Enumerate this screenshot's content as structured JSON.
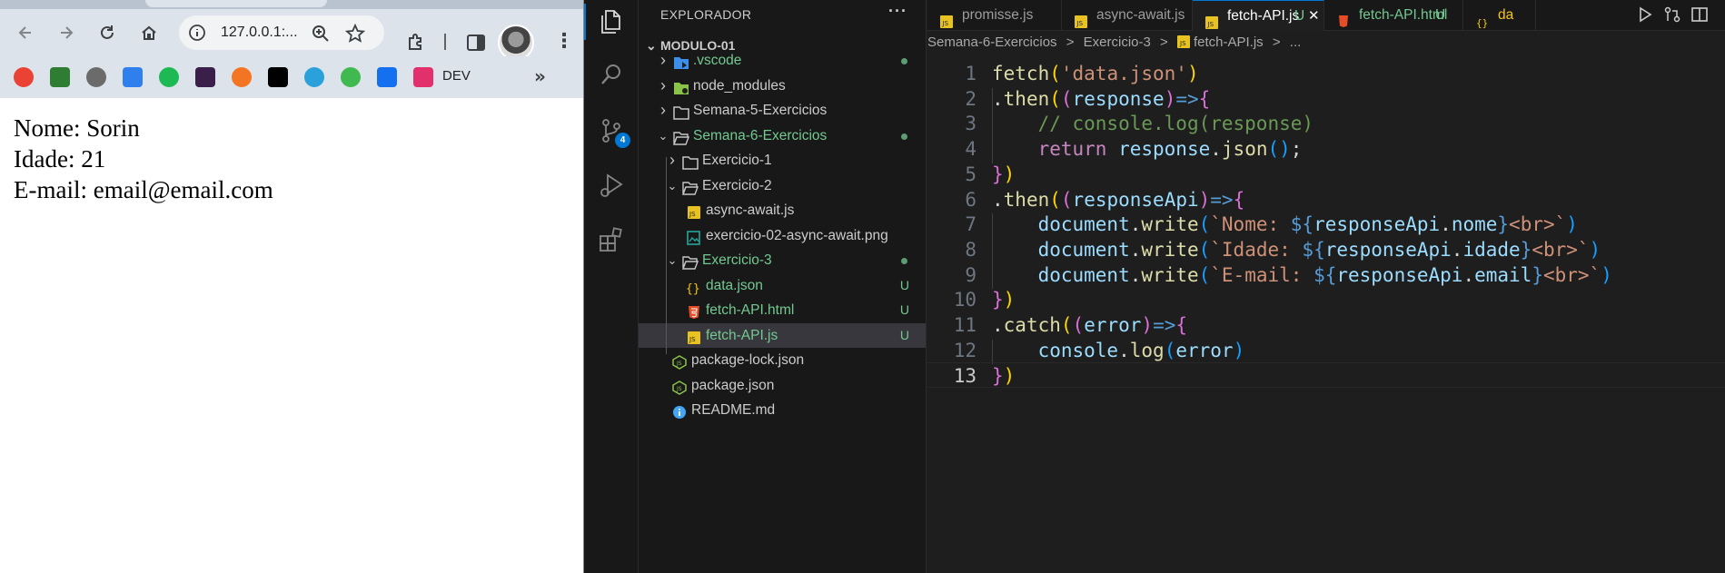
{
  "browser": {
    "url": "127.0.0.1:...",
    "bookmarks": [
      {
        "icon": "chrome-colorful-icon",
        "color": "#ea4335"
      },
      {
        "icon": "sheets-icon",
        "color": "#2f7d32"
      },
      {
        "icon": "globe-icon",
        "color": "#6b6b6b"
      },
      {
        "icon": "cloud-icon",
        "color": "#2f80ed"
      },
      {
        "icon": "spotify-icon",
        "color": "#1db954"
      },
      {
        "icon": "m-icon",
        "color": "#3a1f4b"
      },
      {
        "icon": "crunchyroll-icon",
        "color": "#f47521"
      },
      {
        "icon": "x-icon",
        "color": "#000000"
      },
      {
        "icon": "telegram-icon",
        "color": "#2aa1da"
      },
      {
        "icon": "one-icon",
        "color": "#3fb950"
      },
      {
        "icon": "s-icon",
        "color": "#1570ef"
      },
      {
        "icon": "dev-icon",
        "color": "#e1306c"
      }
    ],
    "bookmark_label": "DEV",
    "page_lines": [
      "Nome: Sorin",
      "Idade: 21",
      "E-mail: email@email.com"
    ]
  },
  "vscode": {
    "explorer_title": "EXPLORADOR",
    "root_folder": "MODULO-01",
    "scm_badge": "4",
    "tree": [
      {
        "label": ".vscode",
        "depth": 1,
        "kind": "folder-vscode",
        "expanded": false,
        "status": "dot",
        "added": true
      },
      {
        "label": "node_modules",
        "depth": 1,
        "kind": "folder-node",
        "expanded": false,
        "status": "",
        "added": false
      },
      {
        "label": "Semana-5-Exercicios",
        "depth": 1,
        "kind": "folder",
        "expanded": false,
        "status": "",
        "added": false
      },
      {
        "label": "Semana-6-Exercicios",
        "depth": 1,
        "kind": "folder-open",
        "expanded": true,
        "status": "dot",
        "added": true
      },
      {
        "label": "Exercicio-1",
        "depth": 2,
        "kind": "folder",
        "expanded": false,
        "status": "",
        "added": false
      },
      {
        "label": "Exercicio-2",
        "depth": 2,
        "kind": "folder-open",
        "expanded": true,
        "status": "",
        "added": false
      },
      {
        "label": "async-await.js",
        "depth": 3,
        "kind": "js",
        "status": "",
        "added": false
      },
      {
        "label": "exercicio-02-async-await.png",
        "depth": 3,
        "kind": "png",
        "status": "",
        "added": false
      },
      {
        "label": "Exercicio-3",
        "depth": 2,
        "kind": "folder-open",
        "expanded": true,
        "status": "dot",
        "added": true
      },
      {
        "label": "data.json",
        "depth": 3,
        "kind": "json",
        "status": "U",
        "added": true
      },
      {
        "label": "fetch-API.html",
        "depth": 3,
        "kind": "html",
        "status": "U",
        "added": true
      },
      {
        "label": "fetch-API.js",
        "depth": 3,
        "kind": "js",
        "status": "U",
        "added": true,
        "selected": true
      },
      {
        "label": "package-lock.json",
        "depth": 1,
        "kind": "npm",
        "status": "",
        "added": false
      },
      {
        "label": "package.json",
        "depth": 1,
        "kind": "npm",
        "status": "",
        "added": false
      },
      {
        "label": "README.md",
        "depth": 1,
        "kind": "info",
        "status": "",
        "added": false
      }
    ],
    "tabs": [
      {
        "label": "promisse.js",
        "kind": "js",
        "status": "",
        "active": false
      },
      {
        "label": "async-await.js",
        "kind": "js",
        "status": "",
        "active": false
      },
      {
        "label": "fetch-API.js",
        "kind": "js",
        "status": "U",
        "active": true
      },
      {
        "label": "fetch-API.html",
        "kind": "html",
        "status": "U",
        "active": false
      },
      {
        "label": "da",
        "kind": "json",
        "status": "",
        "active": false
      }
    ],
    "breadcrumb": [
      "Semana-6-Exercicios",
      ">",
      "Exercicio-3",
      ">",
      "fetch-API.js",
      ">",
      "..."
    ],
    "line_numbers": [
      "1",
      "2",
      "3",
      "4",
      "5",
      "6",
      "7",
      "8",
      "9",
      "10",
      "11",
      "12",
      "13"
    ],
    "current_line": 13,
    "code": [
      [
        [
          "fn",
          "fetch"
        ],
        [
          "b1",
          "("
        ],
        [
          "str",
          "'data.json'"
        ],
        [
          "b1",
          ")"
        ]
      ],
      [
        [
          "p",
          "."
        ],
        [
          "fn",
          "then"
        ],
        [
          "b1",
          "("
        ],
        [
          "b2",
          "("
        ],
        [
          "var",
          "response"
        ],
        [
          "b2",
          ")"
        ],
        [
          "op",
          "=>"
        ],
        [
          "b2",
          "{"
        ]
      ],
      [
        [
          "p",
          "    "
        ],
        [
          "com",
          "// console.log(response)"
        ]
      ],
      [
        [
          "p",
          "    "
        ],
        [
          "kw",
          "return"
        ],
        [
          "p",
          " "
        ],
        [
          "var",
          "response"
        ],
        [
          "p",
          "."
        ],
        [
          "fn",
          "json"
        ],
        [
          "b3",
          "()"
        ],
        [
          "p",
          ";"
        ]
      ],
      [
        [
          "b2",
          "}"
        ],
        [
          "b1",
          ")"
        ]
      ],
      [
        [
          "p",
          "."
        ],
        [
          "fn",
          "then"
        ],
        [
          "b1",
          "("
        ],
        [
          "b2",
          "("
        ],
        [
          "var",
          "responseApi"
        ],
        [
          "b2",
          ")"
        ],
        [
          "op",
          "=>"
        ],
        [
          "b2",
          "{"
        ]
      ],
      [
        [
          "p",
          "    "
        ],
        [
          "var",
          "document"
        ],
        [
          "p",
          "."
        ],
        [
          "fn",
          "write"
        ],
        [
          "b3",
          "("
        ],
        [
          "str",
          "`Nome: "
        ],
        [
          "tpl",
          "${"
        ],
        [
          "var",
          "responseApi"
        ],
        [
          "p",
          "."
        ],
        [
          "var",
          "nome"
        ],
        [
          "tpl",
          "}"
        ],
        [
          "str",
          "<br>`"
        ],
        [
          "b3",
          ")"
        ]
      ],
      [
        [
          "p",
          "    "
        ],
        [
          "var",
          "document"
        ],
        [
          "p",
          "."
        ],
        [
          "fn",
          "write"
        ],
        [
          "b3",
          "("
        ],
        [
          "str",
          "`Idade: "
        ],
        [
          "tpl",
          "${"
        ],
        [
          "var",
          "responseApi"
        ],
        [
          "p",
          "."
        ],
        [
          "var",
          "idade"
        ],
        [
          "tpl",
          "}"
        ],
        [
          "str",
          "<br>`"
        ],
        [
          "b3",
          ")"
        ]
      ],
      [
        [
          "p",
          "    "
        ],
        [
          "var",
          "document"
        ],
        [
          "p",
          "."
        ],
        [
          "fn",
          "write"
        ],
        [
          "b3",
          "("
        ],
        [
          "str",
          "`E-mail: "
        ],
        [
          "tpl",
          "${"
        ],
        [
          "var",
          "responseApi"
        ],
        [
          "p",
          "."
        ],
        [
          "var",
          "email"
        ],
        [
          "tpl",
          "}"
        ],
        [
          "str",
          "<br>`"
        ],
        [
          "b3",
          ")"
        ]
      ],
      [
        [
          "b2",
          "}"
        ],
        [
          "b1",
          ")"
        ]
      ],
      [
        [
          "p",
          "."
        ],
        [
          "fn",
          "catch"
        ],
        [
          "b1",
          "("
        ],
        [
          "b2",
          "("
        ],
        [
          "var",
          "error"
        ],
        [
          "b2",
          ")"
        ],
        [
          "op",
          "=>"
        ],
        [
          "b2",
          "{"
        ]
      ],
      [
        [
          "p",
          "    "
        ],
        [
          "var",
          "console"
        ],
        [
          "p",
          "."
        ],
        [
          "fn",
          "log"
        ],
        [
          "b3",
          "("
        ],
        [
          "var",
          "error"
        ],
        [
          "b3",
          ")"
        ]
      ],
      [
        [
          "b2",
          "}"
        ],
        [
          "b1",
          ")"
        ]
      ]
    ]
  }
}
